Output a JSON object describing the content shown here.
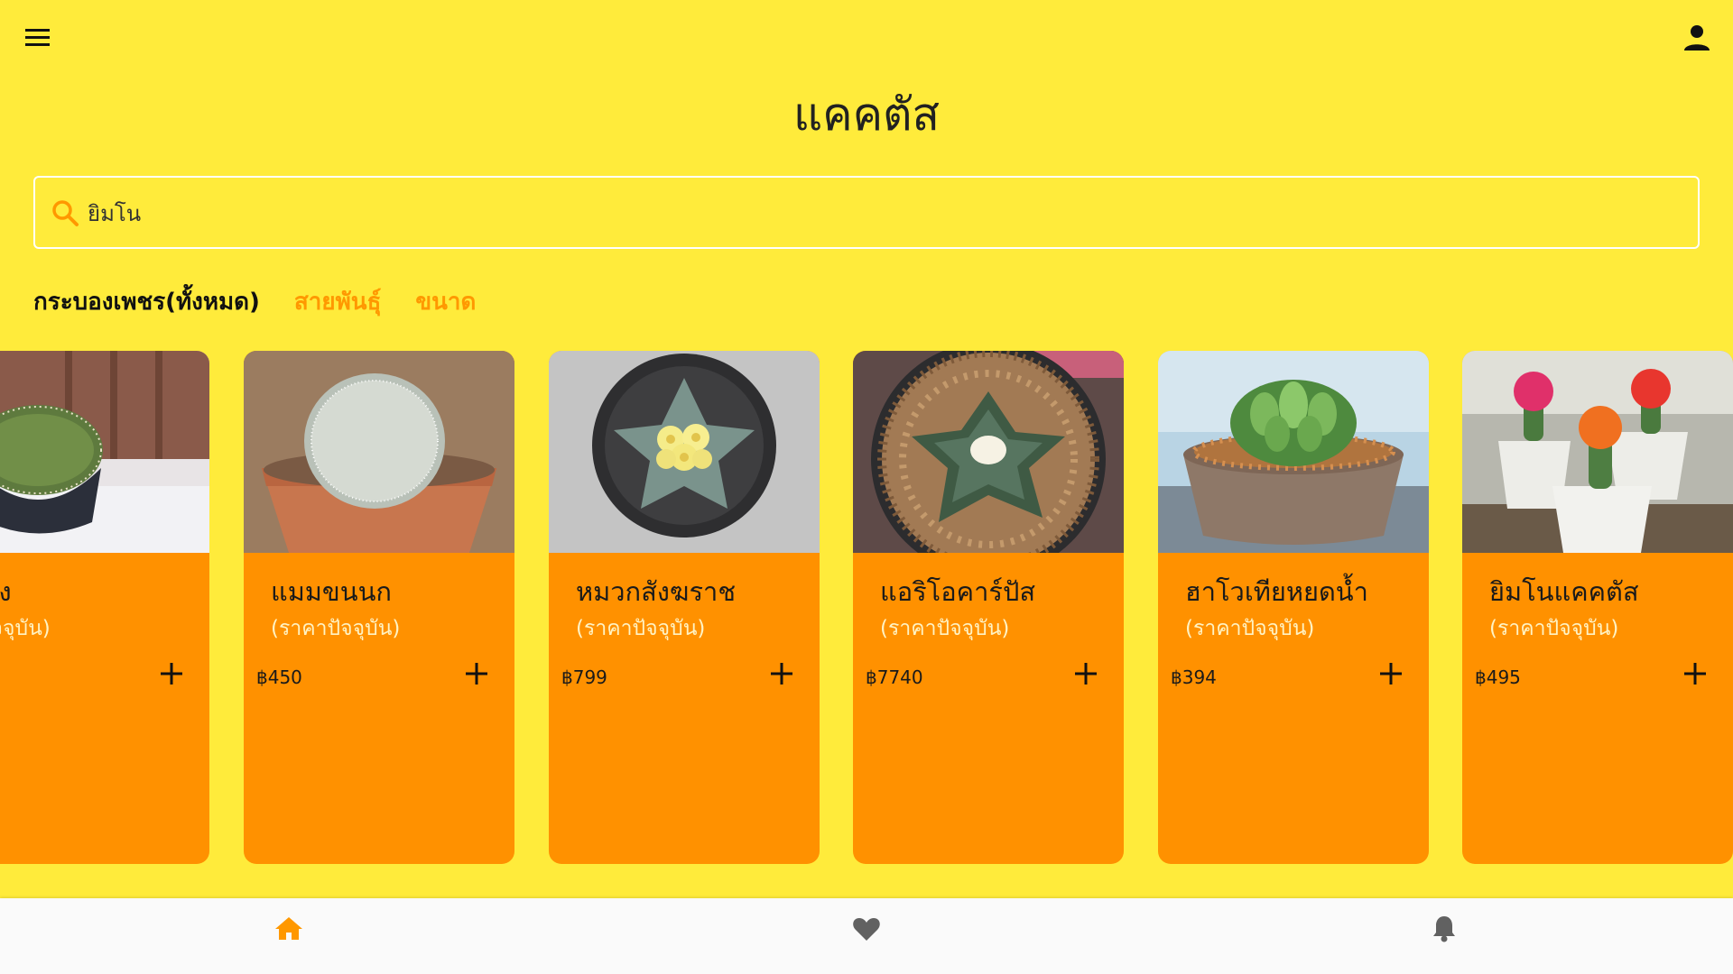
{
  "header": {
    "title": "แคคตัส",
    "menu_icon": "menu-icon",
    "account_icon": "account-icon"
  },
  "search": {
    "value": "ยิมโน",
    "icon": "search-icon",
    "icon_color": "#FF9800"
  },
  "tabs": [
    {
      "label": "กระบองเพชร(ทั้งหมด)",
      "active": true
    },
    {
      "label": "สายพันธุ์",
      "active": false
    },
    {
      "label": "ขนาด",
      "active": false
    }
  ],
  "cards": [
    {
      "name": "ทอง",
      "subtitle": "าปัจจุบัน)",
      "price": "",
      "image": "cactus-photo-golden-barrel"
    },
    {
      "name": "แมมขนนก",
      "subtitle": "(ราคาปัจจุบัน)",
      "price": "฿450",
      "image": "cactus-photo-mammillaria"
    },
    {
      "name": "หมวกสังฆราช",
      "subtitle": "(ราคาปัจจุบัน)",
      "price": "฿799",
      "image": "cactus-photo-astrophytum"
    },
    {
      "name": "แอริโอคาร์ปัส",
      "subtitle": "(ราคาปัจจุบัน)",
      "price": "฿7740",
      "image": "cactus-photo-ariocarpus"
    },
    {
      "name": "ฮาโวเทียหยดน้ำ",
      "subtitle": "(ราคาปัจจุบัน)",
      "price": "฿394",
      "image": "cactus-photo-haworthia"
    },
    {
      "name": "ยิมโนแคคตัส",
      "subtitle": "(ราคาปัจจุบัน)",
      "price": "฿495",
      "image": "cactus-photo-gymnocalycium"
    }
  ],
  "bottom_nav": [
    {
      "icon": "home-icon",
      "active": true
    },
    {
      "icon": "heart-icon",
      "active": false
    },
    {
      "icon": "bell-icon",
      "active": false
    }
  ],
  "colors": {
    "background": "#FFEB3B",
    "card": "#FF9100",
    "accent": "#FF9800",
    "nav_background": "#FAFAFA",
    "nav_inactive": "#616161"
  }
}
